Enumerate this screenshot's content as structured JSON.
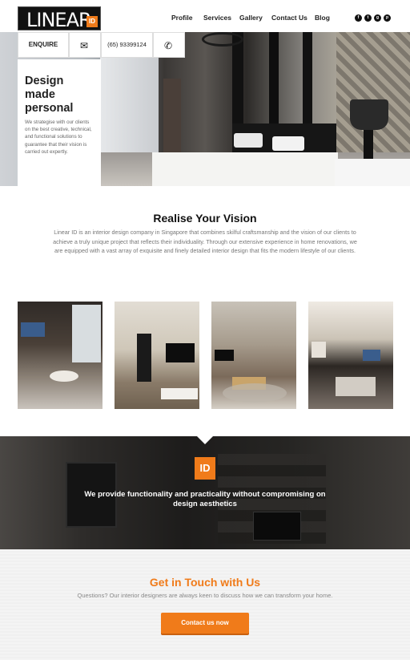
{
  "brand": {
    "logo_text": "LINEAR",
    "logo_badge": "ID"
  },
  "nav": {
    "items": [
      {
        "label": "Profile"
      },
      {
        "label": "Services"
      },
      {
        "label": "Gallery"
      },
      {
        "label": "Contact Us"
      },
      {
        "label": "Blog"
      }
    ],
    "social_icons": [
      "facebook-icon",
      "twitter-icon",
      "google-plus-icon",
      "pinterest-icon"
    ]
  },
  "enquiry": {
    "enquire_label": "ENQUIRE",
    "phone": "(65) 93399124"
  },
  "hero": {
    "title": "Design made personal",
    "text": "We strategise with our clients on the best creative, technical, and functional solutions to guarantee that their vision is carried out expertly."
  },
  "intro": {
    "title": "Realise Your Vision",
    "text": "Linear ID is an interior design company in Singapore that combines skilful craftsmanship and the vision of our clients to achieve a truly unique project that reflects their individuality. Through our extensive experience in home renovations, we are equipped with a vast array of exquisite and finely detailed interior design that fits the modern lifestyle of our clients."
  },
  "feature": {
    "badge": "ID",
    "text": "We provide functionality and practicality without compromising on design aesthetics"
  },
  "contact": {
    "title": "Get in Touch with Us",
    "subtitle": "Questions? Our interior designers are always keen to discuss how we can transform your home.",
    "button": "Contact us now"
  },
  "colors": {
    "accent": "#f07b1a",
    "text": "#222222",
    "muted": "#777777"
  }
}
